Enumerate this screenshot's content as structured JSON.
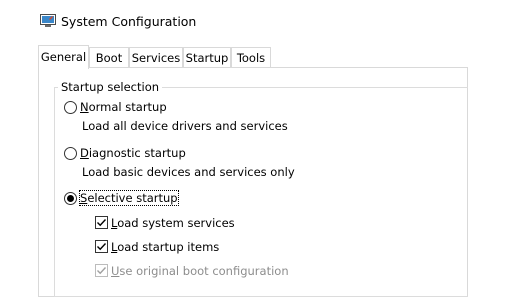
{
  "window": {
    "title": "System Configuration",
    "icon": "system-configuration-icon"
  },
  "tabs": [
    {
      "label": "General",
      "active": true
    },
    {
      "label": "Boot",
      "active": false
    },
    {
      "label": "Services",
      "active": false
    },
    {
      "label": "Startup",
      "active": false
    },
    {
      "label": "Tools",
      "active": false
    }
  ],
  "startup_selection": {
    "group_label": "Startup selection",
    "options": [
      {
        "mnemonic": "N",
        "rest": "ormal startup",
        "description": "Load all device drivers and services",
        "selected": false
      },
      {
        "mnemonic": "D",
        "rest": "iagnostic startup",
        "description": "Load basic devices and services only",
        "selected": false
      },
      {
        "mnemonic": "S",
        "rest": "elective startup",
        "description": "",
        "selected": true
      }
    ],
    "selective_items": [
      {
        "mnemonic": "L",
        "rest": "oad system services",
        "checked": true,
        "disabled": false
      },
      {
        "mnemonic": "L",
        "rest": "oad startup items",
        "checked": true,
        "disabled": false
      },
      {
        "mnemonic": "U",
        "rest": "se original boot configuration",
        "checked": true,
        "disabled": true
      }
    ]
  },
  "colors": {
    "border": "#d9d9d9",
    "disabled_text": "#8d8d8d",
    "text": "#000000"
  }
}
